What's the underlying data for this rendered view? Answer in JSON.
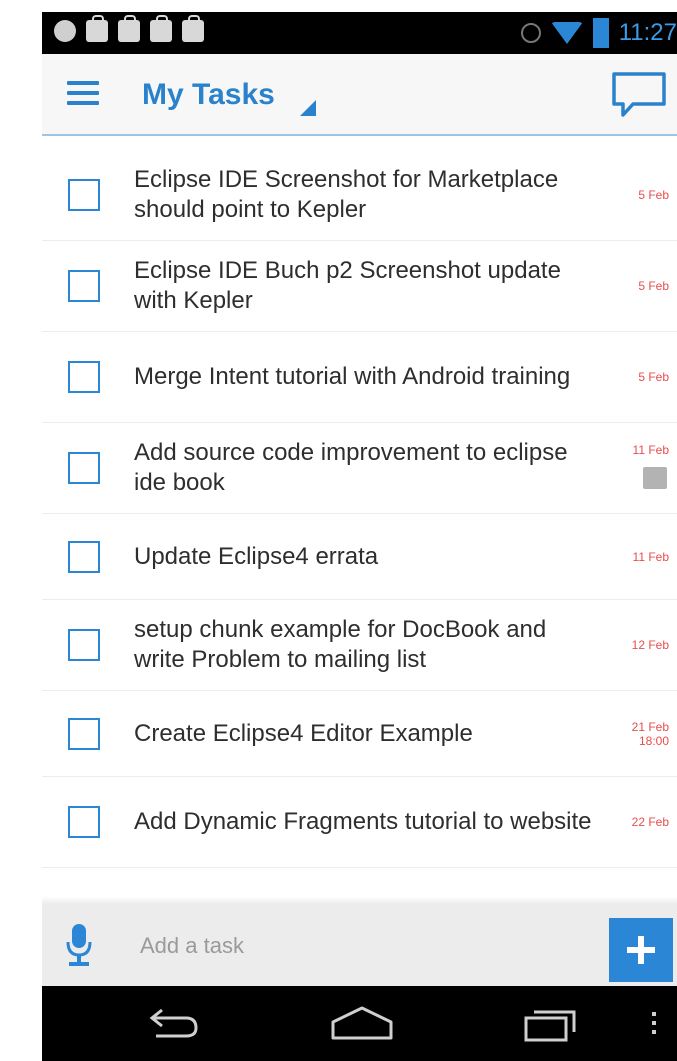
{
  "status_bar": {
    "time": "11:27"
  },
  "action_bar": {
    "title": "My Tasks"
  },
  "tasks": [
    {
      "title": "Eclipse IDE Screenshot for Marketplace should point to Kepler",
      "date": "5 Feb"
    },
    {
      "title": "Eclipse IDE Buch p2 Screenshot update with Kepler",
      "date": "5 Feb"
    },
    {
      "title": "Merge Intent tutorial with Android training",
      "date": "5 Feb"
    },
    {
      "title": "Add source code improvement to eclipse ide book",
      "date": "11 Feb"
    },
    {
      "title": "Update Eclipse4 errata",
      "date": "11 Feb"
    },
    {
      "title": "setup chunk example for DocBook and write Problem to mailing list",
      "date": "12 Feb"
    },
    {
      "title": "Create Eclipse4 Editor Example",
      "date": "21 Feb",
      "time": "18:00"
    },
    {
      "title": "Add Dynamic Fragments tutorial to website",
      "date": "22 Feb"
    }
  ],
  "input_bar": {
    "placeholder": "Add a task"
  },
  "colors": {
    "accent": "#2b86d6",
    "date_red": "#e84d4d",
    "status_bar_bg": "#000000"
  },
  "icons": {
    "status_left": [
      "android-icon",
      "shopping-bag-icon",
      "shopping-bag-icon",
      "shopping-bag-icon",
      "shopping-bag-icon"
    ],
    "status_right": [
      "alarm-icon",
      "wifi-icon",
      "signal-icon",
      "battery-icon"
    ],
    "action_bar": [
      "menu-icon",
      "chat-icon"
    ],
    "input_bar": [
      "microphone-icon",
      "plus-icon"
    ],
    "nav": [
      "back-icon",
      "home-icon",
      "recent-apps-icon",
      "overflow-menu-icon"
    ]
  }
}
